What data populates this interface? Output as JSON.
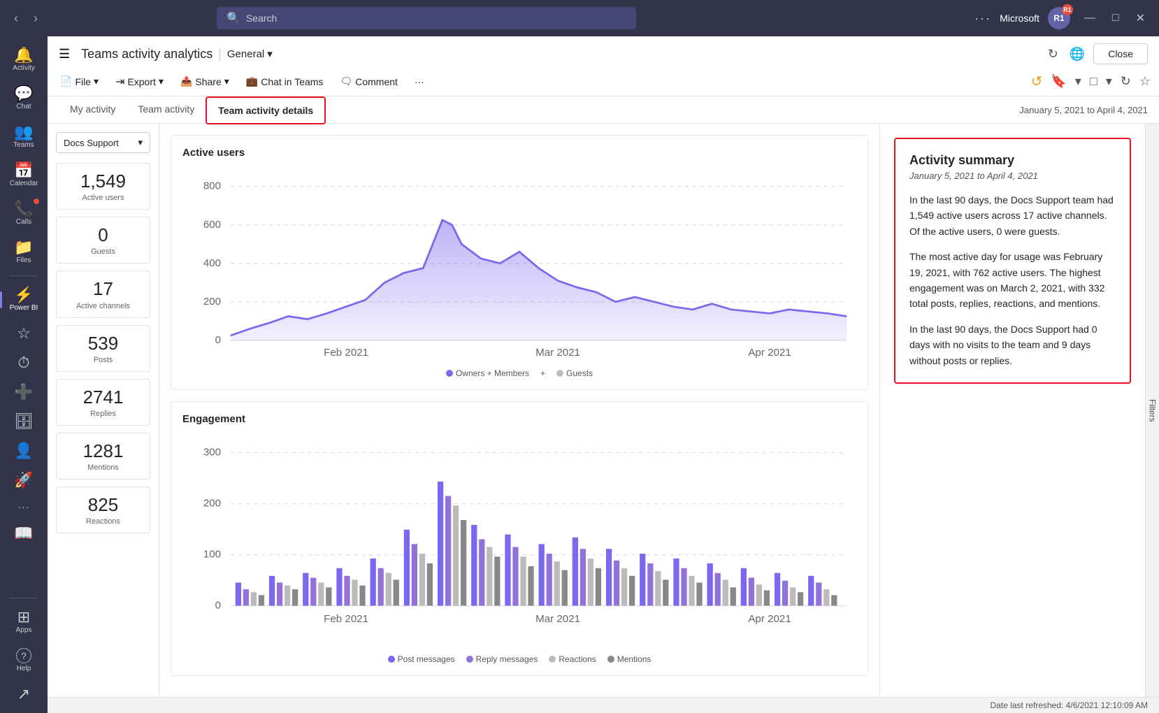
{
  "titlebar": {
    "search_placeholder": "Search",
    "org_name": "Microsoft",
    "avatar_initials": "R1",
    "back_btn": "‹",
    "forward_btn": "›",
    "ellipsis": "···",
    "minimize": "—",
    "maximize": "□",
    "close": "✕"
  },
  "sidebar": {
    "items": [
      {
        "id": "activity",
        "label": "Activity",
        "icon": "🔔",
        "active": false
      },
      {
        "id": "chat",
        "label": "Chat",
        "icon": "💬",
        "active": false
      },
      {
        "id": "teams",
        "label": "Teams",
        "icon": "👥",
        "active": false
      },
      {
        "id": "calendar",
        "label": "Calendar",
        "icon": "📅",
        "active": false
      },
      {
        "id": "calls",
        "label": "Calls",
        "icon": "📞",
        "active": false,
        "badge": true
      },
      {
        "id": "files",
        "label": "Files",
        "icon": "📁",
        "active": false
      },
      {
        "id": "powerbi",
        "label": "Power BI",
        "icon": "⚡",
        "active": true
      }
    ],
    "bottom_items": [
      {
        "id": "apps",
        "label": "Apps",
        "icon": "⊞"
      },
      {
        "id": "help",
        "label": "Help",
        "icon": "?"
      }
    ],
    "extra_items": [
      {
        "icon": "☆",
        "label": ""
      },
      {
        "icon": "⏱",
        "label": ""
      },
      {
        "icon": "➕",
        "label": ""
      },
      {
        "icon": "🗄",
        "label": ""
      },
      {
        "icon": "👤",
        "label": ""
      },
      {
        "icon": "🚀",
        "label": ""
      },
      {
        "icon": "···",
        "label": ""
      },
      {
        "icon": "📖",
        "label": ""
      }
    ]
  },
  "header": {
    "app_title": "Teams activity analytics",
    "separator": "|",
    "breadcrumb": "General",
    "chevron": "▾",
    "close_label": "Close",
    "refresh_icon": "↻",
    "globe_icon": "🌐"
  },
  "menubar": {
    "items": [
      {
        "id": "file",
        "label": "File",
        "icon": "📄",
        "has_arrow": true
      },
      {
        "id": "export",
        "label": "Export",
        "icon": "⇥",
        "has_arrow": true
      },
      {
        "id": "share",
        "label": "Share",
        "icon": "📤",
        "has_arrow": true
      },
      {
        "id": "chat-in-teams",
        "label": "Chat in Teams",
        "icon": "💬",
        "has_arrow": false
      },
      {
        "id": "comment",
        "label": "Comment",
        "icon": "🗨",
        "has_arrow": false
      },
      {
        "id": "more",
        "label": "···",
        "has_arrow": false
      }
    ],
    "toolbar_icons": [
      {
        "id": "undo",
        "icon": "↺"
      },
      {
        "id": "bookmark",
        "icon": "🔖"
      },
      {
        "id": "bookmark-chevron",
        "icon": "▾"
      },
      {
        "id": "view",
        "icon": "□"
      },
      {
        "id": "view-chevron",
        "icon": "▾"
      },
      {
        "id": "refresh",
        "icon": "↻"
      },
      {
        "id": "star",
        "icon": "☆"
      }
    ]
  },
  "tabs": {
    "items": [
      {
        "id": "my-activity",
        "label": "My activity",
        "active": false
      },
      {
        "id": "team-activity",
        "label": "Team activity",
        "active": false
      },
      {
        "id": "team-activity-details",
        "label": "Team activity details",
        "active": true
      }
    ],
    "date_range": "January 5, 2021 to April 4, 2021"
  },
  "filter_dropdown": {
    "value": "Docs Support",
    "chevron": "▾"
  },
  "metrics": [
    {
      "id": "active-users",
      "value": "1,549",
      "label": "Active users"
    },
    {
      "id": "guests",
      "value": "0",
      "label": "Guests"
    },
    {
      "id": "active-channels",
      "value": "17",
      "label": "Active channels"
    },
    {
      "id": "posts",
      "value": "539",
      "label": "Posts"
    },
    {
      "id": "replies",
      "value": "2741",
      "label": "Replies"
    },
    {
      "id": "mentions",
      "value": "1281",
      "label": "Mentions"
    },
    {
      "id": "reactions",
      "value": "825",
      "label": "Reactions"
    }
  ],
  "charts": {
    "active_users": {
      "title": "Active users",
      "y_labels": [
        "800",
        "600",
        "400",
        "200",
        "0"
      ],
      "x_labels": [
        "Feb 2021",
        "Mar 2021",
        "Apr 2021"
      ],
      "legend": [
        {
          "label": "Owners + Members",
          "color": "#7b68ee"
        },
        {
          "label": "Guests",
          "color": "#ccc"
        }
      ]
    },
    "engagement": {
      "title": "Engagement",
      "y_labels": [
        "300",
        "200",
        "100",
        "0"
      ],
      "x_labels": [
        "Feb 2021",
        "Mar 2021",
        "Apr 2021"
      ],
      "legend": [
        {
          "label": "Post messages",
          "color": "#7b68ee"
        },
        {
          "label": "Reply messages",
          "color": "#9370db"
        },
        {
          "label": "Reactions",
          "color": "#b0b0b0"
        },
        {
          "label": "Mentions",
          "color": "#888"
        }
      ]
    }
  },
  "summary": {
    "title": "Activity summary",
    "date_range": "January 5, 2021 to April 4, 2021",
    "paragraphs": [
      "In the last 90 days, the Docs Support team had 1,549 active users across 17 active channels. Of the active users, 0 were guests.",
      "The most active day for usage was February 19, 2021, with 762 active users. The highest engagement was on March 2, 2021, with 332 total posts, replies, reactions, and mentions.",
      "In the last 90 days, the Docs Support had 0 days with no visits to the team and 9 days without posts or replies."
    ]
  },
  "status_bar": {
    "text": "Date last refreshed: 4/6/2021 12:10:09 AM"
  },
  "filters_label": "Filters"
}
